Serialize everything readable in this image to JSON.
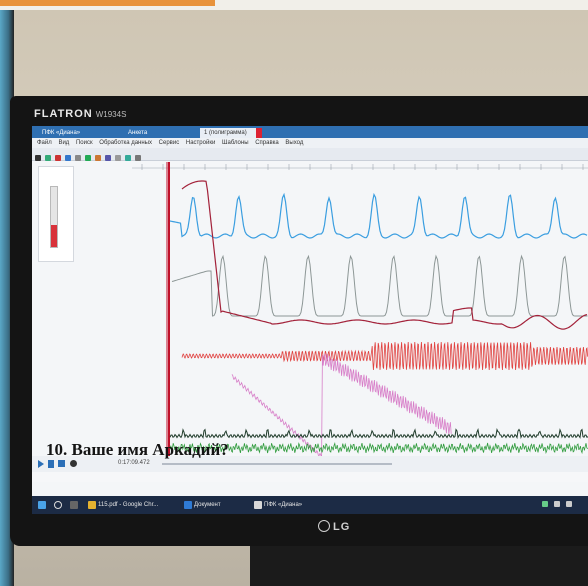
{
  "overlay": {
    "caption": "10. Ваше имя Аркадий?"
  },
  "monitor": {
    "brand": "FLATRON",
    "model": "W1934S",
    "logo": "LG"
  },
  "app": {
    "tabs": [
      "ПФК «Диана»",
      "Анкета",
      "1 (полиграмма)"
    ],
    "menu": [
      "Файл",
      "Вид",
      "Поиск",
      "Обработка данных",
      "Сервис",
      "Настройки",
      "Шаблоны",
      "Справка",
      "Выход"
    ]
  },
  "player": {
    "time": "0:17:09.472",
    "buttons": [
      "play",
      "pause",
      "stop",
      "record"
    ]
  },
  "taskbar": {
    "items": [
      "115.pdf - Google Chr...",
      "Документ",
      "ПФК «Диана»"
    ]
  },
  "colors": {
    "taskbar": "#1c2b45",
    "tabbar": "#2f6fb1",
    "trace_blue": "#3a9ee0",
    "trace_gray": "#8d9796",
    "trace_maroon": "#a3223a",
    "trace_red": "#e0413f",
    "trace_pink": "#d77ec8",
    "trace_green": "#2f9b3c"
  }
}
